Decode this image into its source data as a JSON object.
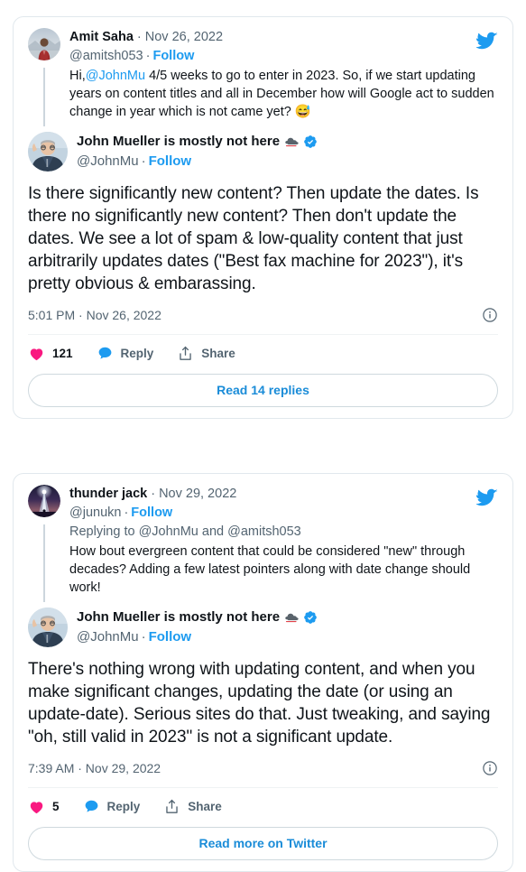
{
  "brand": {
    "twitter_blue": "#1d9bf0",
    "link_blue": "#1a8cd8",
    "like_pink": "#f91880",
    "text_primary": "#0f1419",
    "text_secondary": "#536471",
    "border": "#e1e8ed",
    "bird_icon": "twitter-bird-icon"
  },
  "tweets": [
    {
      "quoted": {
        "avatar_name": "avatar-amit-saha",
        "display_name": "Amit Saha",
        "name_separator": "·",
        "date": "Nov 26, 2022",
        "handle": "@amitsh053",
        "handle_separator": "·",
        "follow_label": "Follow",
        "text_prefix": "Hi,",
        "mention": "@JohnMu",
        "text_body": " 4/5 weeks to go to enter in 2023. So, if we start updating years on content titles and all in December how will Google act to sudden change in year which is not came yet? ",
        "emoji": "😅"
      },
      "main": {
        "avatar_name": "avatar-john-mueller",
        "display_name": "John Mueller is mostly not here",
        "emoji_badge": "cloud-emoji",
        "verified": "verified-badge-icon",
        "handle": "@JohnMu",
        "handle_separator": "·",
        "follow_label": "Follow",
        "text": "Is there significantly new content? Then update the dates. Is there no significantly new content? Then don't update the dates. We see a lot of spam & low-quality content that just arbitrarily updates dates (\"Best fax machine for 2023\"), it's pretty obvious & embarassing.",
        "timestamp": "5:01 PM · Nov 26, 2022",
        "info_icon": "info-circle-icon"
      },
      "actions": {
        "like_icon": "heart-icon",
        "like_count": "121",
        "reply_icon": "speech-bubble-icon",
        "reply_label": "Reply",
        "share_icon": "share-arrow-icon",
        "share_label": "Share"
      },
      "cta_label": "Read 14 replies"
    },
    {
      "quoted": {
        "avatar_name": "avatar-thunder-jack",
        "display_name": "thunder jack",
        "name_separator": "·",
        "date": "Nov 29, 2022",
        "handle": "@junukn",
        "handle_separator": "·",
        "follow_label": "Follow",
        "replying_to": "Replying to @JohnMu and @amitsh053",
        "text_prefix": "",
        "mention": "",
        "text_body": "How bout evergreen content that could be considered \"new\" through decades? Adding a few latest pointers along with date change should work!",
        "emoji": ""
      },
      "main": {
        "avatar_name": "avatar-john-mueller",
        "display_name": "John Mueller is mostly not here",
        "emoji_badge": "cloud-emoji",
        "verified": "verified-badge-icon",
        "handle": "@JohnMu",
        "handle_separator": "·",
        "follow_label": "Follow",
        "text": "There's nothing wrong with updating content, and when you make significant changes, updating the date (or using an update-date). Serious sites do that. Just tweaking, and saying \"oh, still valid in 2023\" is not a significant update.",
        "timestamp": "7:39 AM · Nov 29, 2022",
        "info_icon": "info-circle-icon"
      },
      "actions": {
        "like_icon": "heart-icon",
        "like_count": "5",
        "reply_icon": "speech-bubble-icon",
        "reply_label": "Reply",
        "share_icon": "share-arrow-icon",
        "share_label": "Share"
      },
      "cta_label": "Read more on Twitter"
    }
  ]
}
